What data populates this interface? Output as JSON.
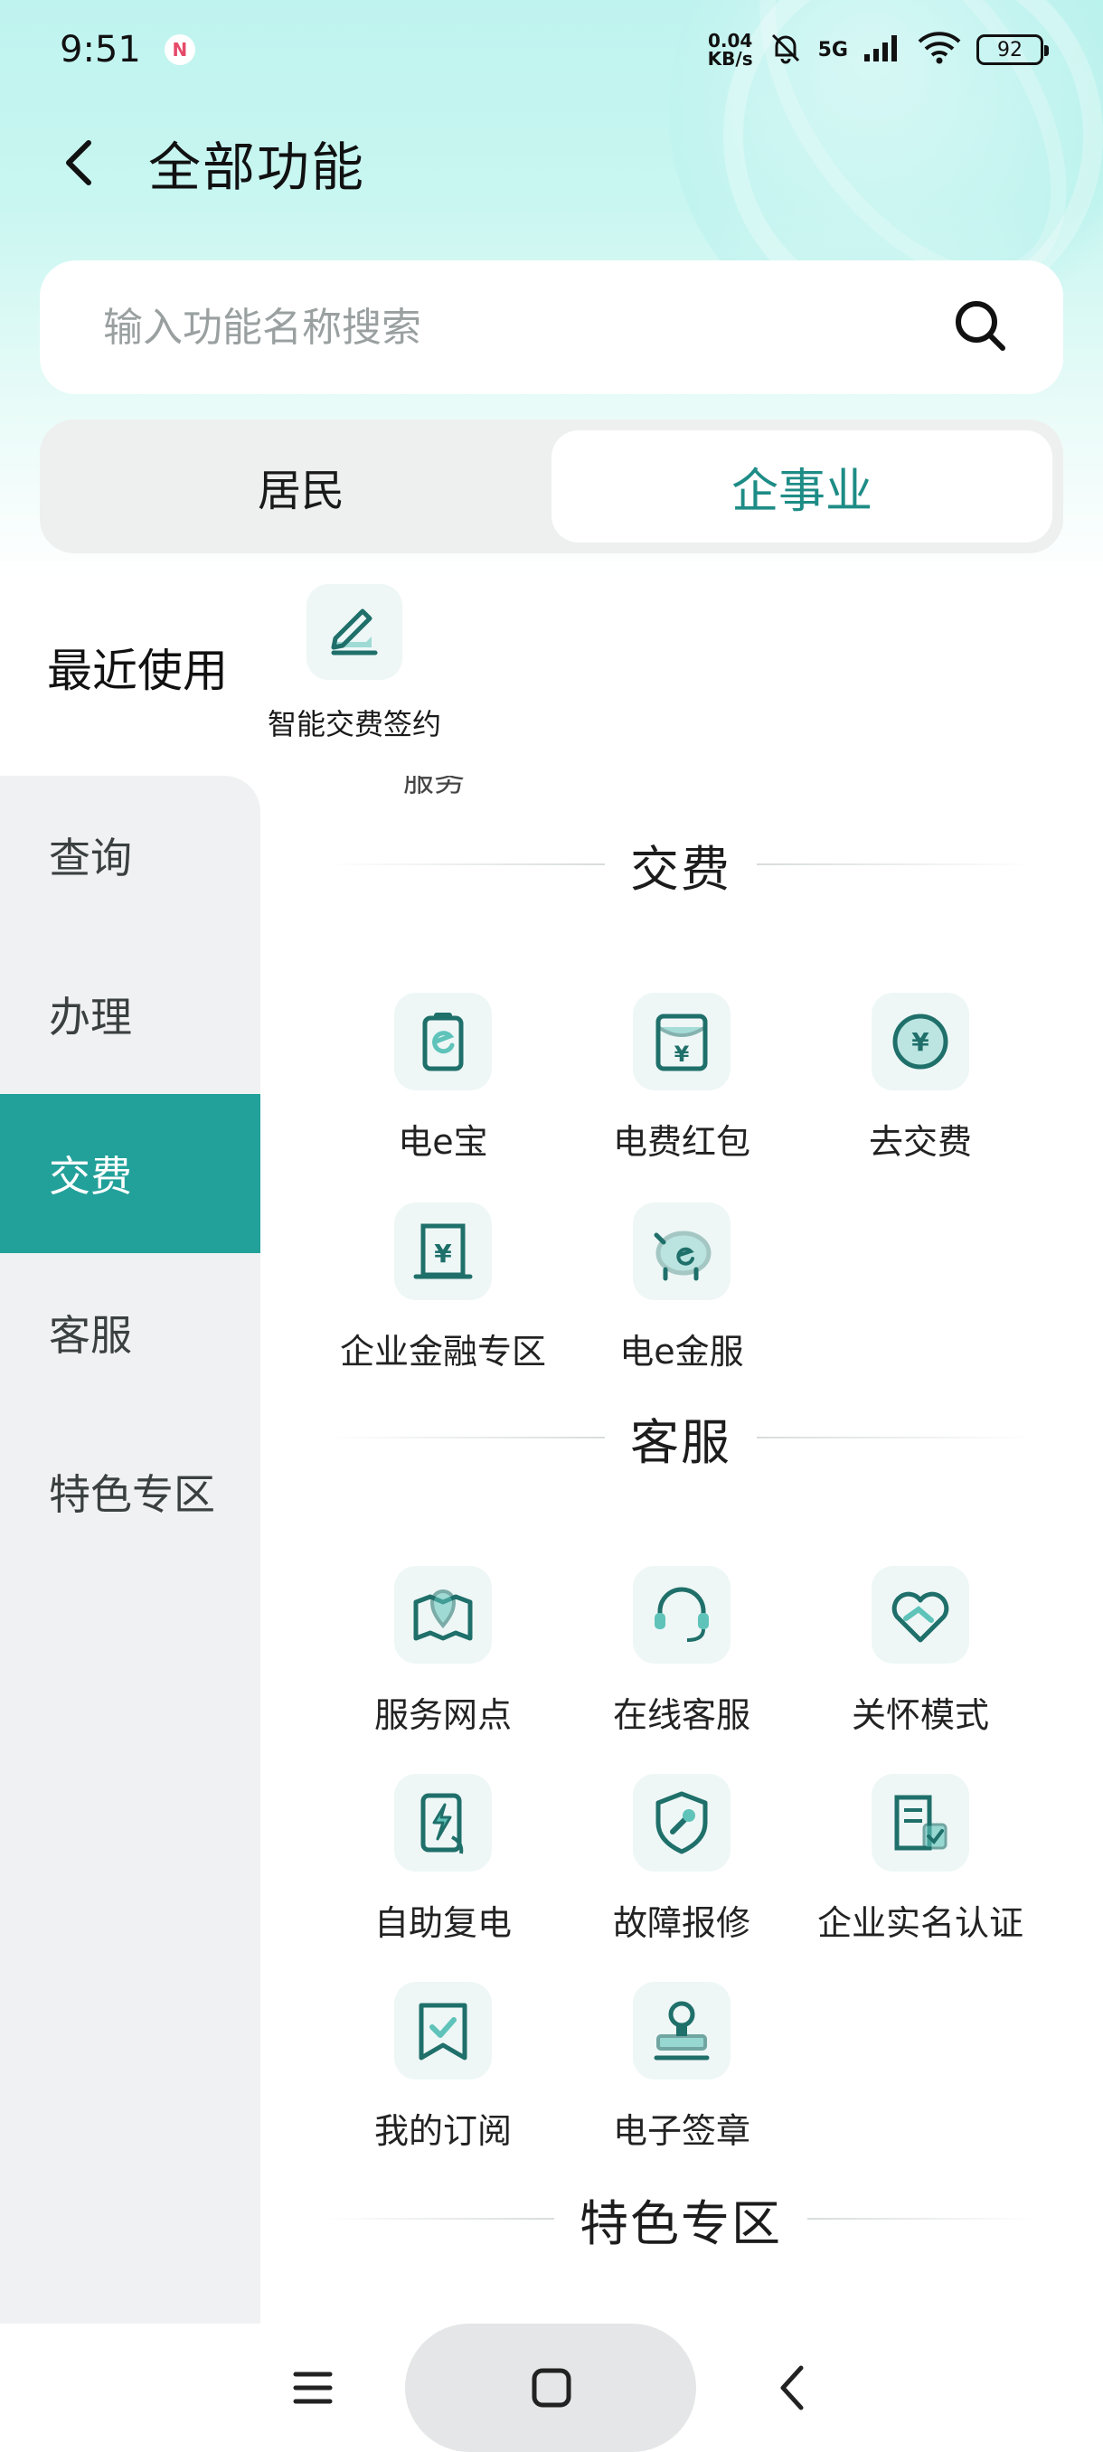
{
  "status_bar": {
    "time": "9:51",
    "notif_badge": "N",
    "speed_top": "0.04",
    "speed_unit": "KB/s",
    "network": "5G",
    "battery": "92"
  },
  "header": {
    "title": "全部功能"
  },
  "search": {
    "placeholder": "输入功能名称搜索"
  },
  "segment": {
    "tabs": [
      {
        "label": "居民",
        "active": false
      },
      {
        "label": "企事业",
        "active": true
      }
    ]
  },
  "recent": {
    "label": "最近使用",
    "items": [
      {
        "label": "智能交费签约",
        "icon": "pen-sign-icon"
      }
    ]
  },
  "sidebar": {
    "items": [
      {
        "label": "查询"
      },
      {
        "label": "办理"
      },
      {
        "label": "交费",
        "active": true
      },
      {
        "label": "客服"
      },
      {
        "label": "特色专区"
      }
    ]
  },
  "content": {
    "cut_off_text": "服务",
    "sections": [
      {
        "title": "交费",
        "items": [
          {
            "label": "电e宝",
            "icon": "e-wallet-icon"
          },
          {
            "label": "电费红包",
            "icon": "red-envelope-icon"
          },
          {
            "label": "去交费",
            "icon": "yuan-coin-icon"
          },
          {
            "label": "企业金融专区",
            "icon": "finance-building-icon"
          },
          {
            "label": "电e金服",
            "icon": "piggy-bank-icon"
          }
        ]
      },
      {
        "title": "客服",
        "items": [
          {
            "label": "服务网点",
            "icon": "map-pin-icon"
          },
          {
            "label": "在线客服",
            "icon": "headset-icon"
          },
          {
            "label": "关怀模式",
            "icon": "care-heart-icon"
          },
          {
            "label": "自助复电",
            "icon": "self-power-icon"
          },
          {
            "label": "故障报修",
            "icon": "repair-shield-icon"
          },
          {
            "label": "企业实名认证",
            "icon": "id-verify-icon"
          },
          {
            "label": "我的订阅",
            "icon": "bookmark-check-icon"
          },
          {
            "label": "电子签章",
            "icon": "seal-stamp-icon"
          }
        ]
      },
      {
        "title": "特色专区",
        "items": []
      }
    ]
  },
  "colors": {
    "accent": "#22a19a",
    "accent_text": "#1e8c86",
    "icon_tile_bg": "#eef7f6",
    "icon_stroke": "#1f6f6a",
    "icon_fill": "#5fc3ba"
  }
}
